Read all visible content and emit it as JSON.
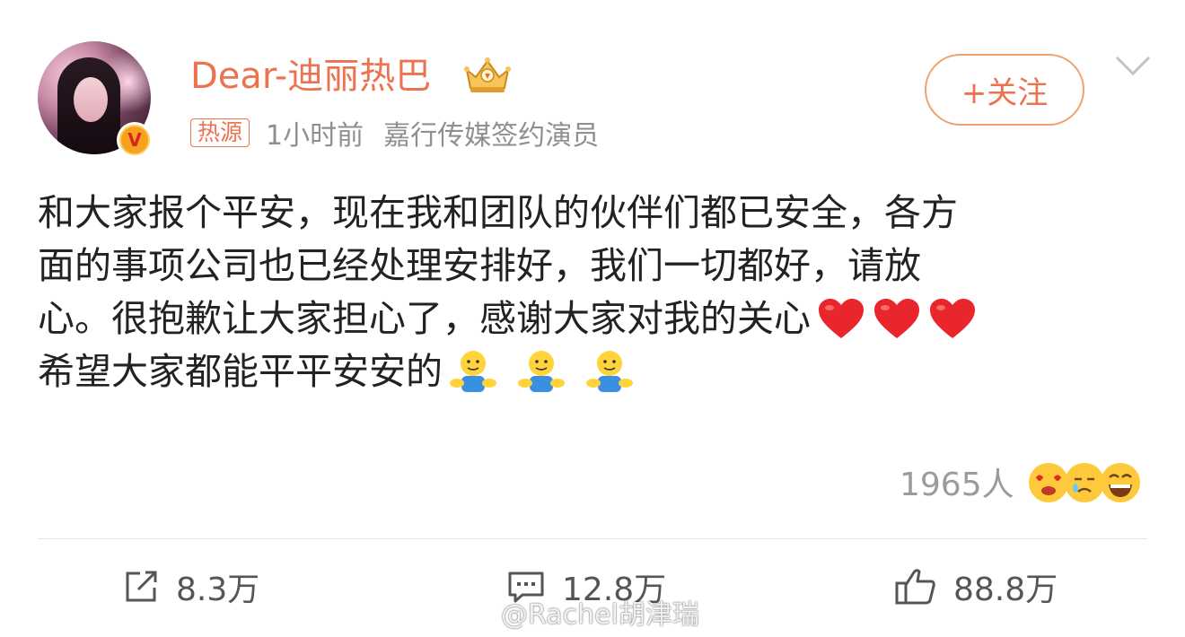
{
  "user": {
    "name": "Dear-迪丽热巴",
    "verified_badge": "V",
    "crown_icon": "crown-icon",
    "follow_label": "+关注"
  },
  "meta": {
    "hot_tag": "热源",
    "time": "1小时前",
    "description": "嘉行传媒签约演员"
  },
  "post": {
    "lines": [
      "和大家报个平安，现在我和团队的伙伴们都已安全，各方",
      "面的事项公司也已经处理安排好，我们一切都好，请放",
      "心。很抱歉让大家担心了，感谢大家对我的关心",
      "希望大家都能平平安安的"
    ],
    "emoji": [
      "heart-icon",
      "hug-icon"
    ]
  },
  "reactions": {
    "count": "1965人",
    "faces": [
      "love-face-icon",
      "cry-face-icon",
      "laugh-face-icon"
    ]
  },
  "actions": {
    "repost": "8.3万",
    "comment": "12.8万",
    "like": "88.8万"
  },
  "watermark": "@Rachel胡津瑞",
  "colors": {
    "accent": "#eb7350",
    "muted": "#8f8f8f",
    "text": "#222222"
  }
}
